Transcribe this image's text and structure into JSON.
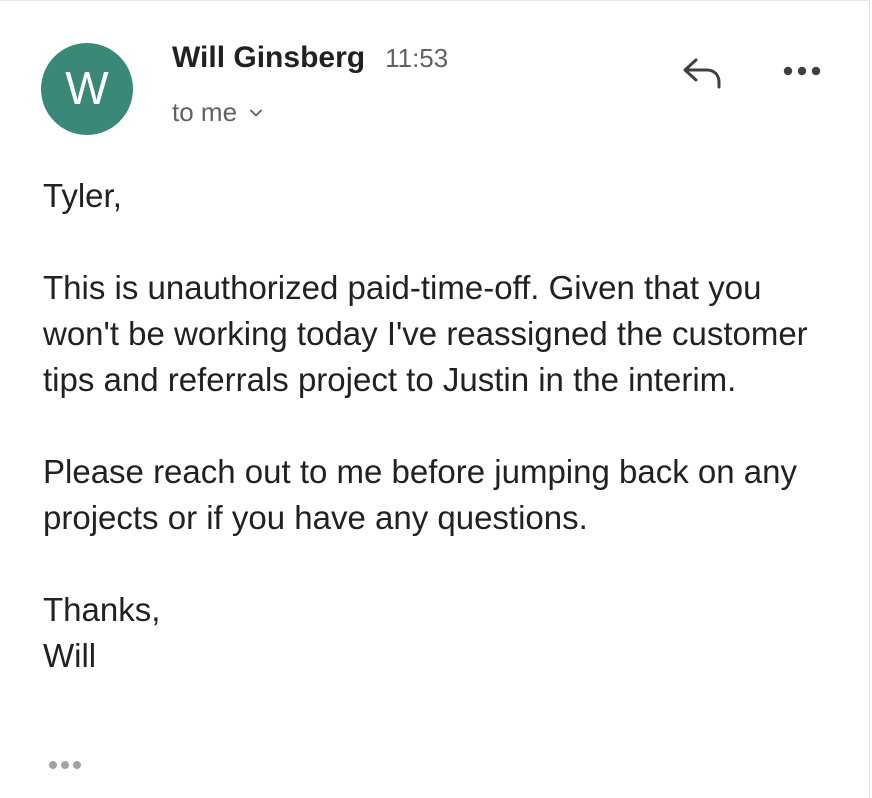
{
  "sender": {
    "initial": "W",
    "avatar_color": "#3a8877",
    "name": "Will Ginsberg",
    "time": "11:53"
  },
  "recipient": {
    "label": "to me",
    "expand_icon": "chevron-down-icon"
  },
  "actions": {
    "reply_icon": "reply-icon",
    "more_icon": "more-horizontal-icon"
  },
  "body": {
    "paragraphs": [
      "Tyler,",
      "This is unauthorized paid-time-off. Given that you won't be working today I've reassigned the customer tips and referrals project to Justin in the interim.",
      "Please reach out to me before jumping back on any projects or if you have any questions.",
      "Thanks,\nWill"
    ]
  },
  "footer": {
    "trimmed_content_icon": "ellipsis-icon"
  }
}
